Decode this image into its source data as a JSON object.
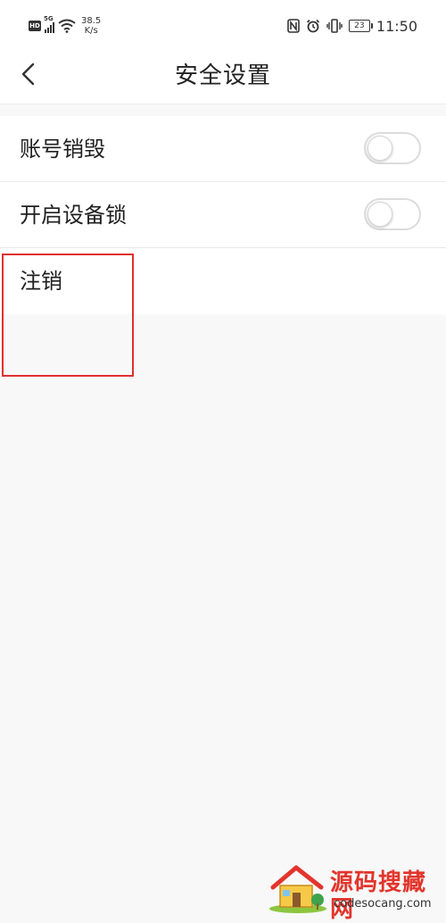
{
  "status_bar": {
    "hd_label": "HD",
    "network_label": "5G",
    "speed_value": "38.5",
    "speed_unit": "K/s",
    "battery_level": "23",
    "time": "11:50",
    "icons": [
      "nfc-icon",
      "alarm-icon",
      "vibrate-icon",
      "battery-icon"
    ]
  },
  "header": {
    "back_icon": "chevron-left-icon",
    "title": "安全设置"
  },
  "settings": {
    "items": [
      {
        "label": "账号销毁",
        "type": "toggle",
        "enabled": false
      },
      {
        "label": "开启设备锁",
        "type": "toggle",
        "enabled": false
      },
      {
        "label": "注销",
        "type": "action"
      }
    ]
  },
  "annotation": {
    "color": "#e0302f"
  },
  "watermark": {
    "title": "源码搜藏网",
    "url": "codesocang.com",
    "color": "#e2352c"
  }
}
